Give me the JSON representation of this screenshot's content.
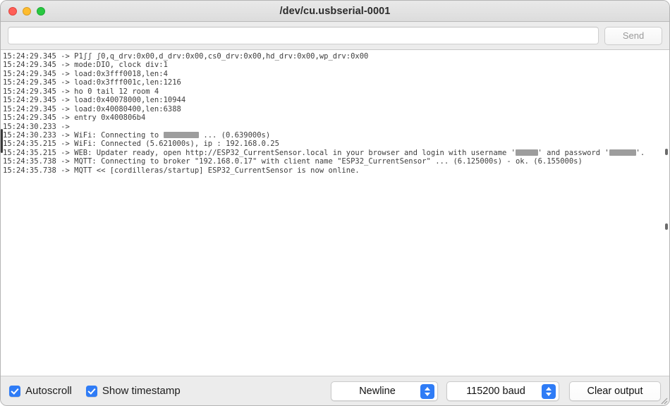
{
  "window": {
    "title": "/dev/cu.usbserial-0001",
    "traffic_lights": [
      "close",
      "minimize",
      "maximize"
    ]
  },
  "send_bar": {
    "input_value": "",
    "input_placeholder": "",
    "send_label": "Send"
  },
  "log": {
    "lines": [
      {
        "timestamp": "15:24:29.345",
        "arrow": "->",
        "text": "P1ʃʃ ʃ0,q_drv:0x00,d_drv:0x00,cs0_drv:0x00,hd_drv:0x00,wp_drv:0x00"
      },
      {
        "timestamp": "15:24:29.345",
        "arrow": "->",
        "text": "mode:DIO, clock div:1"
      },
      {
        "timestamp": "15:24:29.345",
        "arrow": "->",
        "text": "load:0x3fff0018,len:4"
      },
      {
        "timestamp": "15:24:29.345",
        "arrow": "->",
        "text": "load:0x3fff001c,len:1216"
      },
      {
        "timestamp": "15:24:29.345",
        "arrow": "->",
        "text": "ho 0 tail 12 room 4"
      },
      {
        "timestamp": "15:24:29.345",
        "arrow": "->",
        "text": "load:0x40078000,len:10944"
      },
      {
        "timestamp": "15:24:29.345",
        "arrow": "->",
        "text": "load:0x40080400,len:6388"
      },
      {
        "timestamp": "15:24:29.345",
        "arrow": "->",
        "text": "entry 0x400806b4"
      },
      {
        "timestamp": "15:24:30.233",
        "arrow": "->",
        "text": ""
      },
      {
        "timestamp": "15:24:30.233",
        "arrow": "->",
        "text": "WiFi: Connecting to ████████ ... (0.639000s)",
        "redacted": [
          "ssid"
        ]
      },
      {
        "timestamp": "15:24:35.215",
        "arrow": "->",
        "text": "WiFi: Connected (5.621000s), ip : 192.168.0.25"
      },
      {
        "timestamp": "15:24:35.215",
        "arrow": "->",
        "text": "WEB: Updater ready, open http://ESP32_CurrentSensor.local in your browser and login with username '█████' and password '██████'.",
        "redacted": [
          "username",
          "password"
        ]
      },
      {
        "timestamp": "15:24:35.738",
        "arrow": "->",
        "text": "MQTT: Connecting to broker \"192.168.0.17\" with client name \"ESP32_CurrentSensor\" ... (6.125000s) - ok. (6.155000s)"
      },
      {
        "timestamp": "15:24:35.738",
        "arrow": "->",
        "text": "MQTT << [cordilleras/startup] ESP32_CurrentSensor is now online."
      }
    ]
  },
  "bottom_bar": {
    "autoscroll": {
      "label": "Autoscroll",
      "checked": true
    },
    "show_timestamp": {
      "label": "Show timestamp",
      "checked": true
    },
    "line_ending": {
      "selected": "Newline"
    },
    "baud_rate": {
      "selected": "115200 baud"
    },
    "clear_output_label": "Clear output"
  },
  "colors": {
    "accent": "#2f7cf6",
    "titlebar": "#e2e2e2",
    "log_background": "#ffffff",
    "log_text": "#3d3d3d",
    "redaction": "#9d9d9d"
  }
}
